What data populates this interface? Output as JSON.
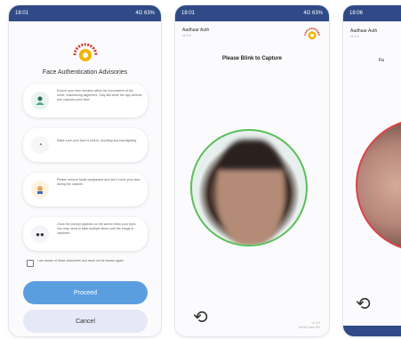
{
  "screen1": {
    "status_time": "18:01",
    "status_right": "4G 63%",
    "title": "Face Authentication Advisories",
    "advisories": [
      {
        "icon": "person-icon",
        "text": "Ensure your face remains within the boundaries of the circle, maintaining alignment. Stay still while the app detects and captures your face."
      },
      {
        "icon": "lighting-icon",
        "text": "Make sure your face is well-lit, avoiding any backlighting."
      },
      {
        "icon": "accessories-icon",
        "text": "Please remove facial eyeglasses and don't cover your face during the capture."
      },
      {
        "icon": "eyes-icon",
        "text": "Once the prompt appears on the screen blink your eyes. You may need to blink multiple times until the image is captured."
      }
    ],
    "checkbox_label": "I am aware of these advisories and need not be shown again",
    "proceed": "Proceed",
    "cancel": "Cancel"
  },
  "screen2": {
    "status_time": "18:01",
    "status_right": "4G 63%",
    "app_title": "Aadhaar Auth",
    "app_sub": "v1.0.0",
    "capture_title": "Please Blink to Capture",
    "version_line1": "v1.0.0",
    "version_line2": "UIDAI Face RD"
  },
  "screen3": {
    "status_time": "18:06",
    "app_title": "Aadhaar Auth",
    "app_sub": "v1.0.0",
    "capture_title": "Fa"
  },
  "colors": {
    "status_bar": "#2f4a86",
    "proceed": "#5b9ee0",
    "match_ring": "#5bbf5a",
    "fail_ring": "#d44444"
  }
}
